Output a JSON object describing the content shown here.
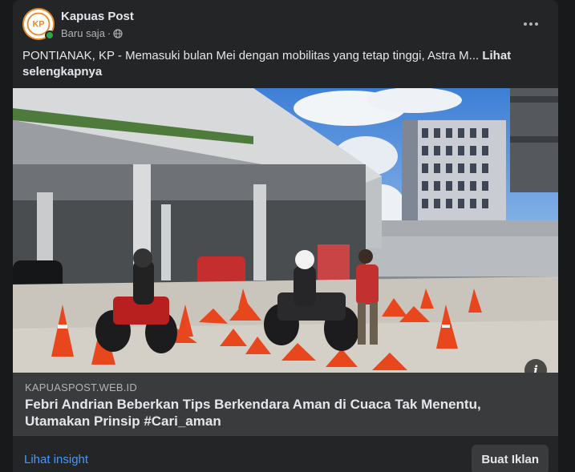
{
  "post": {
    "page_name": "Kapuas Post",
    "timestamp": "Baru saja",
    "separator": "·",
    "audience_icon": "globe-icon",
    "avatar_text": "KP",
    "text": "PONTIANAK, KP - Memasuki bulan Mei dengan mobilitas yang tetap tinggi, Astra M...",
    "see_more": "Lihat selengkapnya",
    "image_alt_icon": "info-icon"
  },
  "link_preview": {
    "domain": "KAPUASPOST.WEB.ID",
    "title": "Febri Andrian Beberkan Tips Berkendara Aman di Cuaca Tak Menentu, Utamakan Prinsip #Cari_aman"
  },
  "footer": {
    "insight_label": "Lihat insight",
    "ad_button_label": "Buat Iklan"
  },
  "colors": {
    "background": "#18191a",
    "card": "#242526",
    "link_meta": "#3a3b3c",
    "accent_link": "#4599ff",
    "online": "#31a24c",
    "brand_orange": "#e98b2b"
  }
}
